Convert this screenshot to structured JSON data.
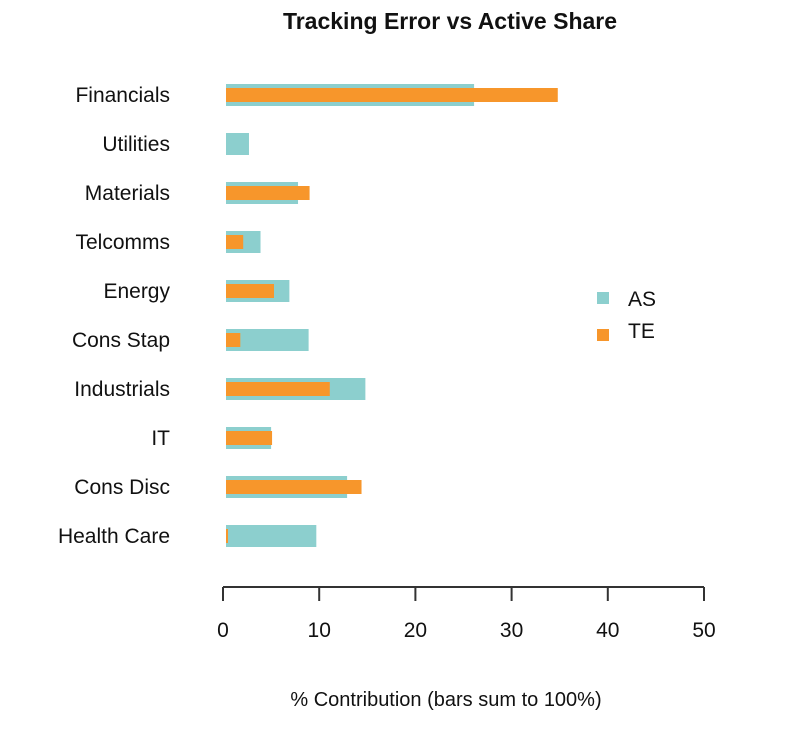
{
  "chart_data": {
    "type": "bar",
    "orientation": "horizontal",
    "title": "Tracking Error vs  Active Share",
    "xlabel": "% Contribution  (bars sum to 100%)",
    "ylabel": "",
    "xlim": [
      0,
      50
    ],
    "xticks": [
      0,
      10,
      20,
      30,
      40,
      50
    ],
    "grid": false,
    "legend_position": "right",
    "categories": [
      "Financials",
      "Utilities",
      "Materials",
      "Telcomms",
      "Energy",
      "Cons Stap",
      "Industrials",
      "IT",
      "Cons Disc",
      "Health Care"
    ],
    "series": [
      {
        "name": "AS",
        "color": "#8ccfce",
        "values": [
          26.1,
          2.7,
          7.8,
          3.9,
          6.9,
          8.9,
          14.8,
          5.0,
          12.9,
          9.7
        ]
      },
      {
        "name": "TE",
        "color": "#f7962b",
        "values": [
          34.8,
          0,
          9.0,
          2.1,
          5.3,
          1.8,
          11.1,
          5.1,
          14.4,
          0.4
        ]
      }
    ]
  }
}
